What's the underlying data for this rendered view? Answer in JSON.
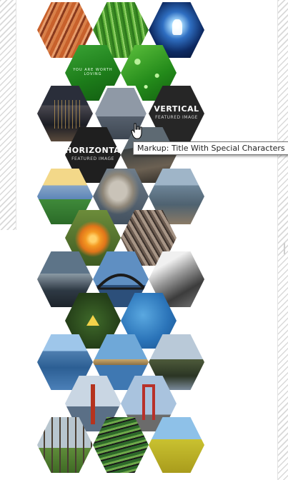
{
  "tooltip": {
    "text": "Markup: Title With Special Characters"
  },
  "hex_tiles": [
    {
      "name": "tile-carrots"
    },
    {
      "name": "tile-grass"
    },
    {
      "name": "tile-unicorn-moon"
    },
    {
      "name": "tile-you-are-worth-loving",
      "caption": "YOU ARE WORTH LOVING"
    },
    {
      "name": "tile-water-drops"
    },
    {
      "name": "tile-city-night"
    },
    {
      "name": "tile-foggy-sea"
    },
    {
      "name": "tile-vertical-featured",
      "title": "VERTICAL",
      "subtitle": "FEATURED IMAGE"
    },
    {
      "name": "tile-horizontal-featured",
      "title": "HORIZONTAL",
      "subtitle": "FEATURED IMAGE"
    },
    {
      "name": "tile-coast-rocks"
    },
    {
      "name": "tile-hillside-sunset"
    },
    {
      "name": "tile-sea-stack-cove"
    },
    {
      "name": "tile-rocky-shore"
    },
    {
      "name": "tile-orange-lily"
    },
    {
      "name": "tile-wooden-wheel"
    },
    {
      "name": "tile-dusk-coast"
    },
    {
      "name": "tile-harbour-bridge"
    },
    {
      "name": "tile-bw-wave"
    },
    {
      "name": "tile-triforce"
    },
    {
      "name": "tile-blue-water"
    },
    {
      "name": "tile-harbour-blue"
    },
    {
      "name": "tile-pier-blue"
    },
    {
      "name": "tile-swamp-trees"
    },
    {
      "name": "tile-golden-gate"
    },
    {
      "name": "tile-red-gate"
    },
    {
      "name": "tile-bare-trees"
    },
    {
      "name": "tile-crop-rows"
    },
    {
      "name": "tile-yellow-field"
    }
  ]
}
